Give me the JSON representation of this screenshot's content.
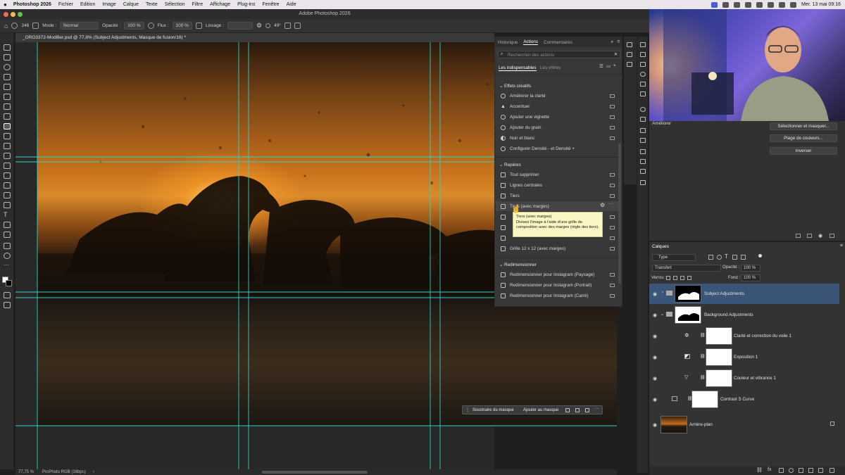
{
  "menubar": {
    "app": "Photoshop 2026",
    "items": [
      "Fichier",
      "Edition",
      "Image",
      "Calque",
      "Texte",
      "Sélection",
      "Filtre",
      "Affichage",
      "Plug-ins",
      "Fenêtre",
      "Aide"
    ],
    "clock": "Mer. 13 mai 09:16"
  },
  "window": {
    "title": "Adobe Photoshop 2026"
  },
  "options": {
    "brush_size": "246",
    "mode_label": "Mode :",
    "mode_value": "Normal",
    "opacity_label": "Opacité :",
    "opacity_value": "100 %",
    "flow_label": "Flux :",
    "flow_value": "100 %",
    "smoothing_label": "Lissage :",
    "angle_value": "49°"
  },
  "document": {
    "tab": "_ORO3372-Modifier.psd @ 77,8% (Subject Adjustments, Masque de fusion/16) *",
    "zoom": "77,75 %",
    "profile": "ProPhoto RGB (16bpc)"
  },
  "actions_panel": {
    "tabs": [
      "Historique",
      "Actions",
      "Commentaires"
    ],
    "search_placeholder": "Rechercher des actions",
    "subtabs": [
      "Les indispensables",
      "Les vôtres"
    ],
    "group1": "Effets créatifs",
    "group1_items": [
      "Améliorer la clarté",
      "Accentuer",
      "Ajouter une vignette",
      "Ajouter du grain",
      "Noir et blanc",
      "Configurer Densité - et Densité +"
    ],
    "group2": "Repères",
    "group2_items": [
      "Tout supprimer",
      "Lignes centrales",
      "Tiers",
      "Tiers (avec marges)",
      "Grille 12 x 12 (avec marges)"
    ],
    "group3": "Redimensionner",
    "group3_items": [
      "Redimensionner pour Instagram (Paysage)",
      "Redimensionner pour Instagram (Portrait)",
      "Redimensionner pour Instagram (Carré)"
    ],
    "tooltip_title": "Tiers (avec marges)",
    "tooltip_body": "Divisez l'image à l'aide d'une grille de composition avec des marges (règle des tiers)."
  },
  "mask_toolbar": {
    "subtract": "Soustraire du masque",
    "add": "Ajouter au masque"
  },
  "properties": {
    "preset": "Améliorer",
    "buttons": [
      "Sélectionner et masquer...",
      "Plage de couleurs...",
      "Inverser"
    ]
  },
  "layers_panel": {
    "title": "Calques",
    "kind_filter": "Type",
    "blend_mode": "Transfert",
    "opacity_label": "Opacité :",
    "opacity_value": "100 %",
    "lock_label": "Verrou :",
    "fill_label": "Fond :",
    "fill_value": "100 %",
    "layers": [
      "Subject Adjustments",
      "Background Adjustments",
      "Clarté et correction du voile 1",
      "Exposition 1",
      "Couleur et vibrance 1",
      "Contrast S Curve",
      "Arrière-plan"
    ]
  },
  "colors": {
    "accent": "#4a5cd6",
    "guide": "#2fd3c6",
    "selection": "#3b5578",
    "tooltip": "#fbf7c4"
  }
}
